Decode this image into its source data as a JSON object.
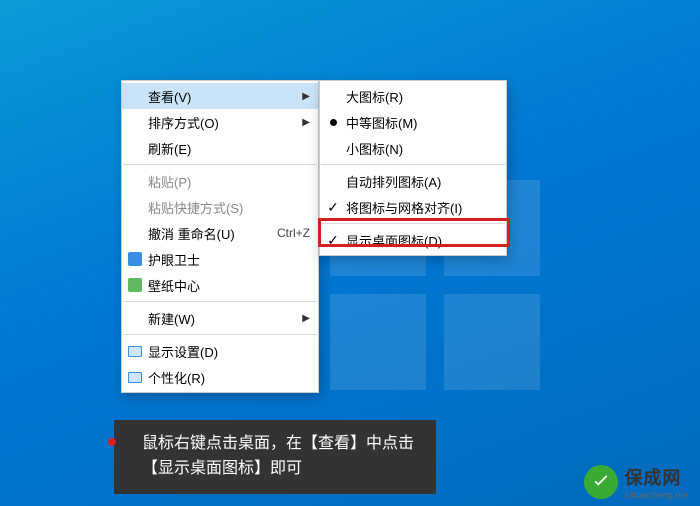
{
  "menu1": {
    "view": "查看(V)",
    "sort": "排序方式(O)",
    "refresh": "刷新(E)",
    "paste": "粘贴(P)",
    "paste_shortcut": "粘贴快捷方式(S)",
    "undo": "撤消 重命名(U)",
    "undo_key": "Ctrl+Z",
    "eye_guard": "护眼卫士",
    "wallpaper": "壁纸中心",
    "new": "新建(W)",
    "display": "显示设置(D)",
    "personalize": "个性化(R)"
  },
  "menu2": {
    "large": "大图标(R)",
    "medium": "中等图标(M)",
    "small": "小图标(N)",
    "auto": "自动排列图标(A)",
    "align": "将图标与网格对齐(I)",
    "show": "显示桌面图标(D)"
  },
  "caption": {
    "line1": "鼠标右键点击桌面，在【查看】中点击",
    "line2": "【显示桌面图标】即可"
  },
  "watermark": {
    "cn": "保成网",
    "en": "zsbaocheng.net"
  }
}
